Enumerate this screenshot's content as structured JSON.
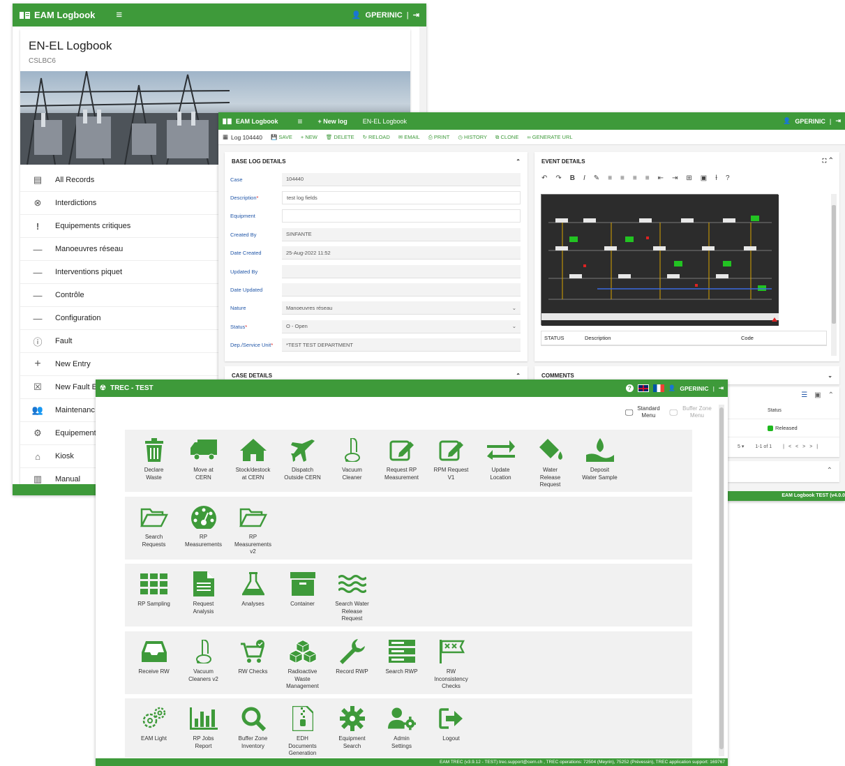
{
  "colors": {
    "brand_green": "#3e9a3a",
    "field_label": "#2257a8",
    "required": "#dd2222"
  },
  "logbook": {
    "app_title": "EAM Logbook",
    "user": "GPERINIC",
    "page_title": "EN-EL Logbook",
    "page_code": "CSLBC6",
    "menu": [
      {
        "icon": "list-icon",
        "label": "All Records"
      },
      {
        "icon": "cancel-circle-icon",
        "label": "Interdictions"
      },
      {
        "icon": "exclamation-icon",
        "label": "Equipements critiques"
      },
      {
        "icon": "dash-icon",
        "label": "Manoeuvres réseau"
      },
      {
        "icon": "dash-icon",
        "label": "Interventions piquet"
      },
      {
        "icon": "dash-icon",
        "label": "Contrôle"
      },
      {
        "icon": "dash-icon",
        "label": "Configuration"
      },
      {
        "icon": "alert-circle-icon",
        "label": "Fault"
      },
      {
        "icon": "plus-icon",
        "label": "New Entry"
      },
      {
        "icon": "close-box-icon",
        "label": "New Fault E"
      },
      {
        "icon": "people-icon",
        "label": "Maintenanc"
      },
      {
        "icon": "gear-icon",
        "label": "Equipement"
      },
      {
        "icon": "kiosk-icon",
        "label": "Kiosk"
      },
      {
        "icon": "book-icon",
        "label": "Manual"
      }
    ]
  },
  "log": {
    "app_title": "EAM Logbook",
    "new_log": "+ New log",
    "logbook_name": "EN-EL Logbook",
    "user": "GPERINIC",
    "log_id": "Log 104440",
    "toolbar": [
      "SAVE",
      "NEW",
      "DELETE",
      "RELOAD",
      "EMAIL",
      "PRINT",
      "HISTORY",
      "CLONE",
      "GENERATE URL"
    ],
    "base_title": "BASE LOG DETAILS",
    "fields": [
      {
        "label": "Case",
        "value": "104440",
        "required": false
      },
      {
        "label": "Description",
        "value": "test log fields",
        "required": true
      },
      {
        "label": "Equipment",
        "value": "",
        "required": false
      },
      {
        "label": "Created By",
        "value": "SINFANTE",
        "required": false
      },
      {
        "label": "Date Created",
        "value": "25-Aug-2022 11:52",
        "required": false
      },
      {
        "label": "Updated By",
        "value": "",
        "required": false
      },
      {
        "label": "Date Updated",
        "value": "",
        "required": false
      },
      {
        "label": "Nature",
        "value": "Manoeuvres réseau",
        "required": false
      },
      {
        "label": "Status",
        "value": "O - Open",
        "required": true
      },
      {
        "label": "Dep./Service Unit",
        "value": "*TEST TEST DEPARTMENT",
        "required": true
      }
    ],
    "case_title": "CASE DETAILS",
    "event_title": "EVENT DETAILS",
    "event_table": {
      "col1": "STATUS",
      "col2": "Description",
      "col3": "Code"
    },
    "comments_title": "COMMENTS",
    "status_header": "Status",
    "status_value": "Released",
    "pager": {
      "per_page": "5",
      "range": "1-1 of 1"
    },
    "footer": "EAM Logbook TEST (v4.0.0"
  },
  "trec": {
    "title": "TREC - TEST",
    "user": "GPERINIC",
    "standard_menu": "Standard Menu",
    "buffer_menu": "Buffer Zone Menu",
    "rows": [
      [
        {
          "icon": "trash-icon",
          "label": "Declare\nWaste"
        },
        {
          "icon": "truck-icon",
          "label": "Move at\nCERN"
        },
        {
          "icon": "home-icon",
          "label": "Stock/destock\nat CERN"
        },
        {
          "icon": "plane-icon",
          "label": "Dispatch\nOutside CERN"
        },
        {
          "icon": "vacuum-icon",
          "label": "Vacuum\nCleaner"
        },
        {
          "icon": "edit-box-icon",
          "label": "Request RP\nMeasurement"
        },
        {
          "icon": "edit-box-icon",
          "label": "RPM Request\nV1"
        },
        {
          "icon": "swap-arrows-icon",
          "label": "Update\nLocation"
        },
        {
          "icon": "paint-bucket-icon",
          "label": "Water\nRelease\nRequest"
        },
        {
          "icon": "water-drop-icon",
          "label": "Deposit\nWater Sample"
        }
      ],
      [
        {
          "icon": "folder-open-icon",
          "label": "Search\nRequests"
        },
        {
          "icon": "gauge-icon",
          "label": "RP\nMeasurements"
        },
        {
          "icon": "folder-open-icon",
          "label": "RP\nMeasurements\nv2"
        }
      ],
      [
        {
          "icon": "grid-icon",
          "label": "RP Sampling"
        },
        {
          "icon": "document-icon",
          "label": "Request\nAnalysis"
        },
        {
          "icon": "flask-icon",
          "label": "Analyses"
        },
        {
          "icon": "archive-icon",
          "label": "Container"
        },
        {
          "icon": "waves-icon",
          "label": "Search Water\nRelease\nRequest"
        }
      ],
      [
        {
          "icon": "inbox-icon",
          "label": "Receive RW"
        },
        {
          "icon": "vacuum-icon",
          "label": "Vacuum\nCleaners v2"
        },
        {
          "icon": "cart-check-icon",
          "label": "RW Checks"
        },
        {
          "icon": "cubes-icon",
          "label": "Radioactive\nWaste\nManagement"
        },
        {
          "icon": "wrench-icon",
          "label": "Record RWP"
        },
        {
          "icon": "server-icon",
          "label": "Search RWP"
        },
        {
          "icon": "flags-icon",
          "label": "RW\nInconsistency\nChecks"
        }
      ],
      [
        {
          "icon": "gears-icon",
          "label": "EAM Light"
        },
        {
          "icon": "bar-chart-icon",
          "label": "RP Jobs\nReport"
        },
        {
          "icon": "magnifier-icon",
          "label": "Buffer Zone\nInventory"
        },
        {
          "icon": "zip-file-icon",
          "label": "EDH\nDocuments\nGeneration"
        },
        {
          "icon": "gear-search-icon",
          "label": "Equipment\nSearch"
        },
        {
          "icon": "user-gear-icon",
          "label": "Admin\nSettings"
        },
        {
          "icon": "logout-icon",
          "label": "Logout"
        }
      ]
    ],
    "footer": "EAM TREC (v3.9.12 - TEST)   trec.support@cern.ch , TREC operations: 72504 (Meyrin), 75252 (Prévessin), TREC application support: 169767"
  }
}
